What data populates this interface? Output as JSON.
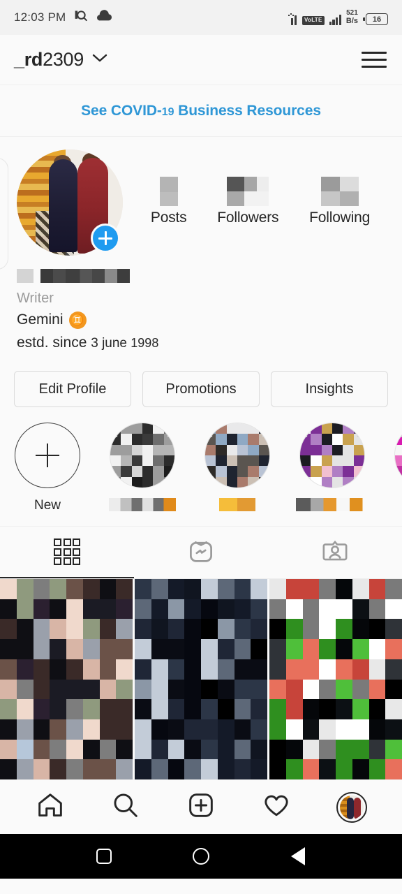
{
  "status_bar": {
    "time": "12:03 PM",
    "icons": [
      "search-in-notification-icon",
      "cloud-icon"
    ],
    "volte_label": "VoLTE",
    "data_speed_value": "521",
    "data_speed_unit": "B/s",
    "battery_level": "16"
  },
  "header": {
    "username_prefix": "_rd",
    "username_suffix": "2309",
    "dropdown_icon": "chevron-down-icon",
    "menu_icon": "hamburger-menu-icon"
  },
  "banner": {
    "text_before": "See COVID-",
    "text_number": "19",
    "text_after": " Business Resources",
    "link_color": "#2f97d6"
  },
  "profile": {
    "avatar_alt": "two-men-in-kurtas-with-marigold-garlands",
    "add_story_icon": "plus-badge-icon",
    "add_story_color": "#1f9bf0",
    "stats": [
      {
        "label": "Posts",
        "value": "[redacted]"
      },
      {
        "label": "Followers",
        "value": "[redacted]"
      },
      {
        "label": "Following",
        "value": "[redacted]"
      }
    ],
    "display_name": "[redacted]",
    "category": "Writer",
    "bio_line_1": "Gemini",
    "bio_emoji": "♊",
    "bio_emoji_color": "#f2971f",
    "bio_line_2_prefix": "estd. since ",
    "bio_line_2_date": "3 june ",
    "bio_line_2_year": "1998"
  },
  "actions": {
    "edit_profile": "Edit Profile",
    "promotions": "Promotions",
    "insights": "Insights"
  },
  "highlights": {
    "new_label": "New",
    "new_icon": "plus-icon",
    "items": [
      {
        "label": "[redacted]"
      },
      {
        "label": "[redacted]"
      },
      {
        "label": "[redacted]"
      },
      {
        "label": "[redacted]"
      }
    ]
  },
  "tabs": [
    {
      "name": "grid",
      "icon": "grid-icon",
      "active": true
    },
    {
      "name": "igtv",
      "icon": "igtv-icon",
      "active": false
    },
    {
      "name": "tagged",
      "icon": "tagged-person-icon",
      "active": false
    }
  ],
  "photo_grid": {
    "posts": [
      {
        "alt": "pixelated-post-1"
      },
      {
        "alt": "pixelated-post-2"
      },
      {
        "alt": "pixelated-post-3"
      }
    ]
  },
  "bottom_nav": [
    {
      "name": "home",
      "icon": "home-icon"
    },
    {
      "name": "search",
      "icon": "search-icon"
    },
    {
      "name": "add-post",
      "icon": "plus-square-icon"
    },
    {
      "name": "activity",
      "icon": "heart-icon"
    },
    {
      "name": "profile",
      "icon": "profile-avatar-icon",
      "active": true
    }
  ],
  "android_nav": [
    {
      "name": "recents",
      "icon": "square-icon"
    },
    {
      "name": "home",
      "icon": "circle-icon"
    },
    {
      "name": "back",
      "icon": "triangle-left-icon"
    }
  ]
}
